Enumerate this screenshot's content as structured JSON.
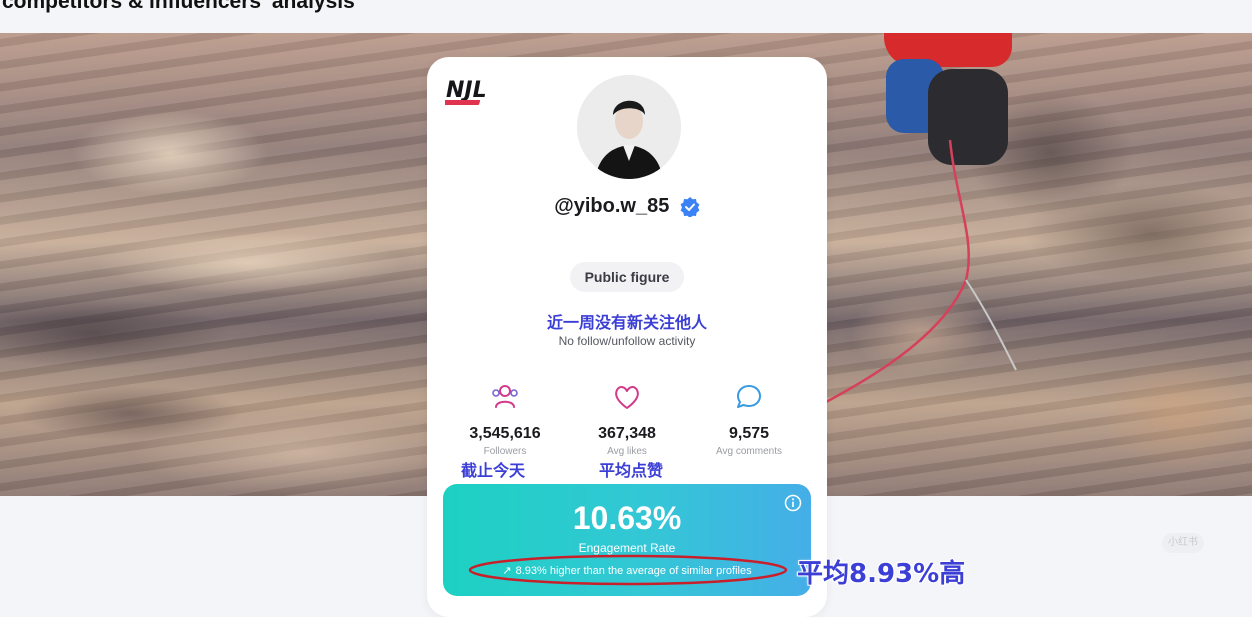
{
  "page": {
    "title": "competitors & influencers' analysis"
  },
  "profile": {
    "handle": "@yibo.w_85",
    "category": "Public figure",
    "activity_status": "No follow/unfollow activity"
  },
  "stats": [
    {
      "value": "3,545,616",
      "label": "Followers",
      "icon": "users-icon"
    },
    {
      "value": "367,348",
      "label": "Avg likes",
      "icon": "heart-icon"
    },
    {
      "value": "9,575",
      "label": "Avg comments",
      "icon": "comment-icon"
    }
  ],
  "engagement": {
    "value": "10.63%",
    "label": "Engagement Rate",
    "comparison": "8.93% higher than the average of similar profiles"
  },
  "annotations": {
    "no_new_follows_week": "近一周没有新关注他人",
    "as_of_today": "截止今天",
    "avg_likes": "平均点赞",
    "avg_higher": "平均8.93%高"
  },
  "watermark": "小红书",
  "colors": {
    "accent_teal": "#1dd1c2",
    "accent_blue": "#45aee8",
    "verified_blue": "#3b82f6",
    "annotation_blue": "#3c3fd6",
    "annotation_red": "#c8202b",
    "brand_red": "#e0334e"
  }
}
